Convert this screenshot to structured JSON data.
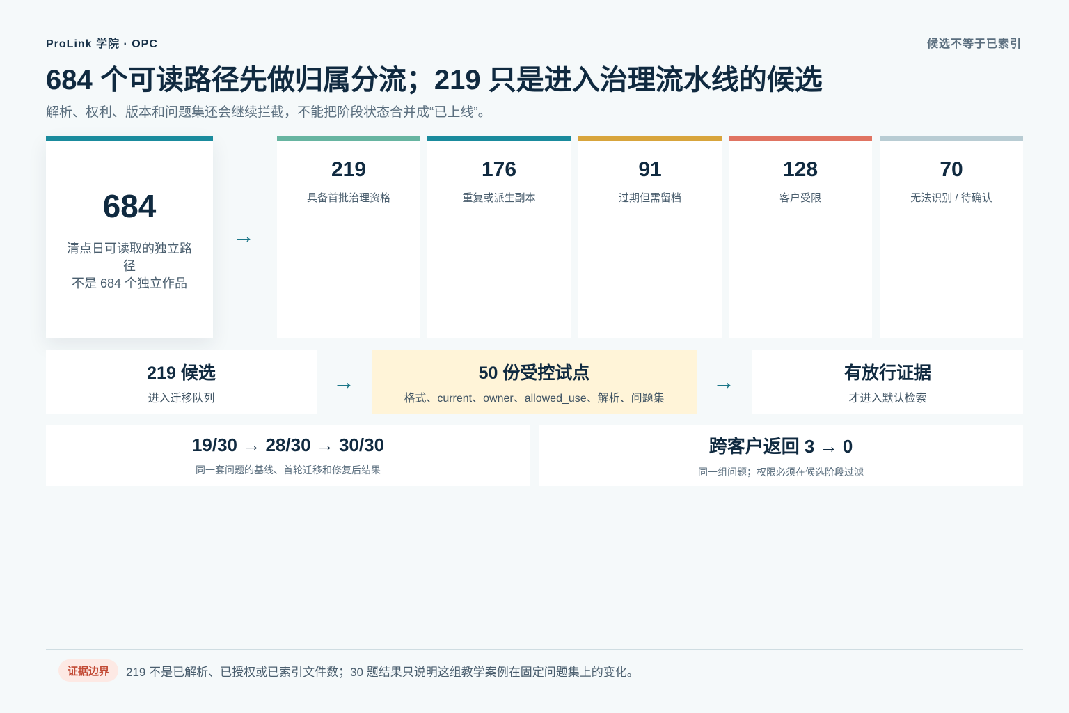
{
  "header": {
    "brand": "ProLink 学院 · OPC",
    "tag": "候选不等于已索引",
    "title": "684 个可读路径先做归属分流；219 只是进入治理流水线的候选",
    "subtitle": "解析、权利、版本和问题集还会继续拦截，不能把阶段状态合并成“已上线”。"
  },
  "source": {
    "value": "684",
    "line1": "清点日可读取的独立路径",
    "line2": "不是 684 个独立作品",
    "accent": "#1a8b9d"
  },
  "arrow": "→",
  "buckets": [
    {
      "value": "219",
      "label": "具备首批治理资格",
      "color": "#67b5a1"
    },
    {
      "value": "176",
      "label": "重复或派生副本",
      "color": "#1a8b9d"
    },
    {
      "value": "91",
      "label": "过期但需留档",
      "color": "#d8a53c"
    },
    {
      "value": "128",
      "label": "客户受限",
      "color": "#e07462"
    },
    {
      "value": "70",
      "label": "无法识别 / 待确认",
      "color": "#b8ccd3"
    }
  ],
  "pipeline": [
    {
      "title": "219 候选",
      "sub": "进入迁移队列"
    },
    {
      "title": "50 份受控试点",
      "sub": "格式、current、owner、allowed_use、解析、问题集"
    },
    {
      "title": "有放行证据",
      "sub": "才进入默认检索"
    }
  ],
  "results": [
    {
      "title": "19/30 → 28/30 → 30/30",
      "sub": "同一套问题的基线、首轮迁移和修复后结果"
    },
    {
      "title": "跨客户返回 3 → 0",
      "sub": "同一组问题；权限必须在候选阶段过滤"
    }
  ],
  "footer": {
    "badge": "证据边界",
    "note": "219 不是已解析、已授权或已索引文件数；30 题结果只说明这组教学案例在固定问题集上的变化。"
  }
}
